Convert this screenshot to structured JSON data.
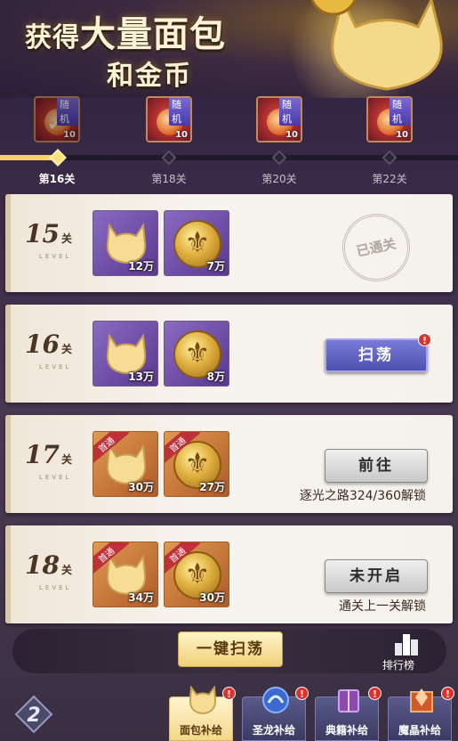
{
  "header": {
    "title_line1_pre": "获得",
    "title_line1_big": "大量面包",
    "title_line2": "和金币"
  },
  "track": {
    "rewards": [
      {
        "tag": "随机",
        "count": "10",
        "claimed": true
      },
      {
        "tag": "随机",
        "count": "10",
        "claimed": false
      },
      {
        "tag": "随机",
        "count": "10",
        "claimed": false
      },
      {
        "tag": "随机",
        "count": "10",
        "claimed": false
      }
    ],
    "levels": [
      "第16关",
      "第18关",
      "第20关",
      "第22关"
    ],
    "progress": 0.12
  },
  "stages": [
    {
      "num": "15",
      "unit": "关",
      "level_word": "LEVEL",
      "bread_amount": "12万",
      "coin_amount": "7万",
      "first": false,
      "status": "已通关"
    },
    {
      "num": "16",
      "unit": "关",
      "level_word": "LEVEL",
      "bread_amount": "13万",
      "coin_amount": "8万",
      "first": false,
      "button": "扫荡"
    },
    {
      "num": "17",
      "unit": "关",
      "level_word": "LEVEL",
      "bread_amount": "30万",
      "coin_amount": "27万",
      "first": true,
      "first_label": "首通",
      "button": "前往",
      "subtext": "逐光之路324/360解锁"
    },
    {
      "num": "18",
      "unit": "关",
      "level_word": "LEVEL",
      "bread_amount": "34万",
      "coin_amount": "30万",
      "first": true,
      "first_label": "首通",
      "button": "未开启",
      "subtext": "通关上一关解锁"
    }
  ],
  "action": {
    "sweep_all": "一键扫荡",
    "rank": "排行榜"
  },
  "tabs": [
    {
      "label": "面包补给",
      "active": true
    },
    {
      "label": "圣龙补给",
      "active": false
    },
    {
      "label": "典籍补给",
      "active": false
    },
    {
      "label": "魔晶补给",
      "active": false
    }
  ],
  "badge": "!"
}
